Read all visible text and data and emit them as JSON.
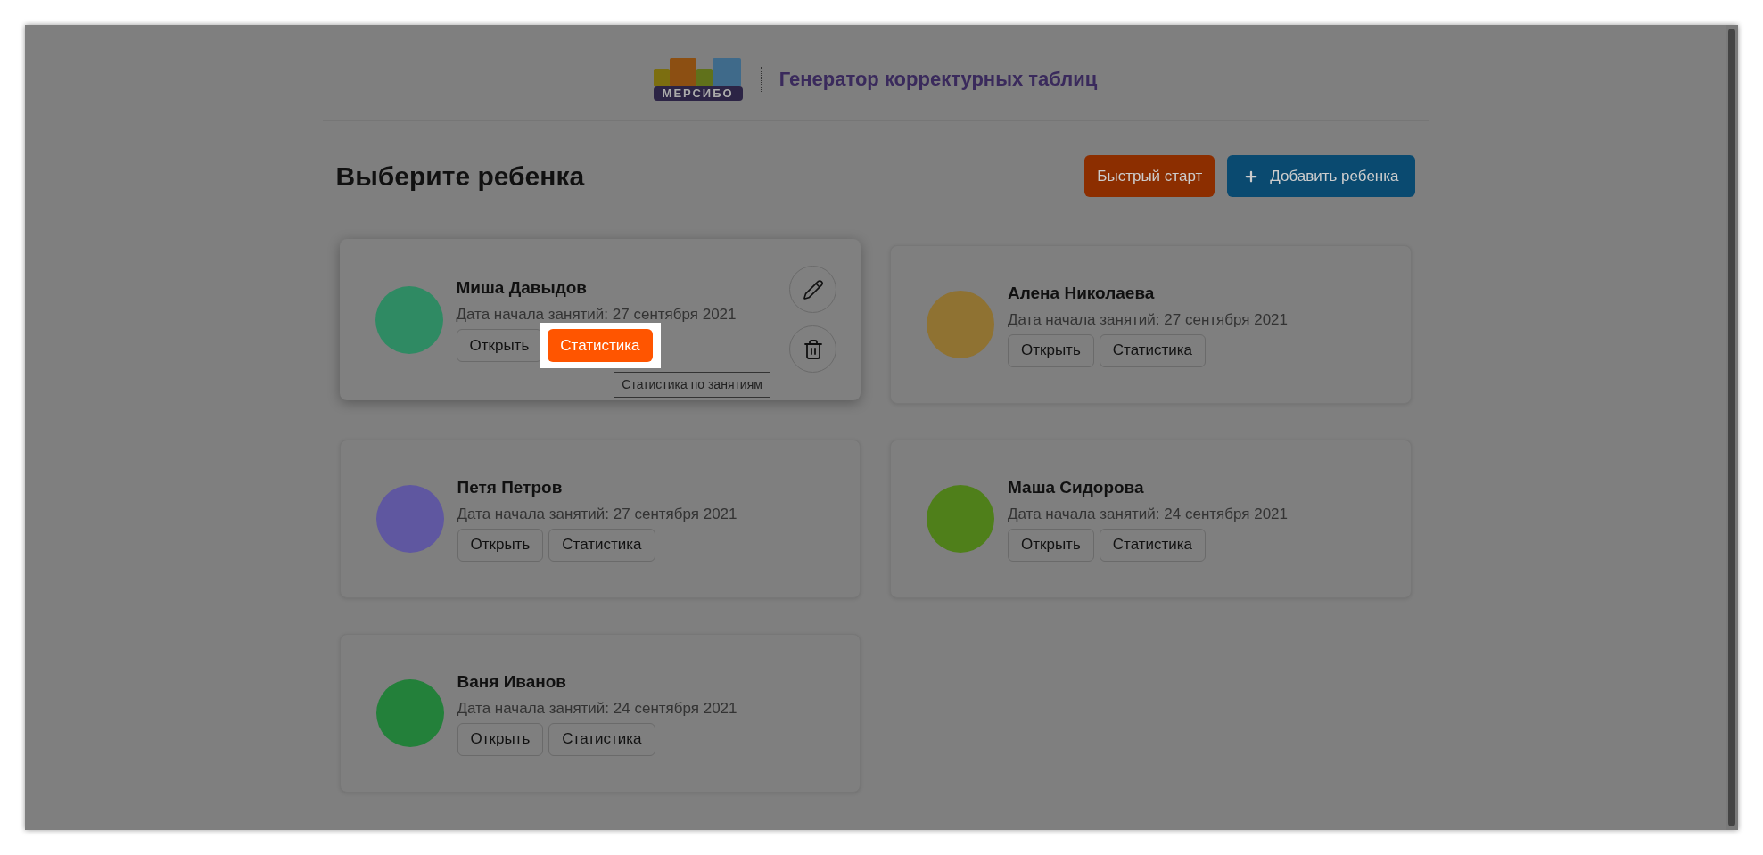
{
  "header": {
    "logo_text": "МЕРСИБО",
    "title": "Генератор корректурных таблиц"
  },
  "page_title": "Выберите ребенка",
  "actions": [
    {
      "kind": "quick",
      "label": "Быстрый старт"
    },
    {
      "kind": "add",
      "label": "Добавить ребенка"
    }
  ],
  "children": [
    {
      "name": "Миша Давыдов",
      "date": "Дата начала занятий: 27 сентября 2021",
      "color": "#2f8a63",
      "hovered": true,
      "buttons": [
        {
          "label": "Открыть",
          "highlighted": false
        },
        {
          "label": "Статистика",
          "highlighted": true,
          "tooltip": "Статистика по занятиям"
        }
      ]
    },
    {
      "name": "Алена Николаева",
      "date": "Дата начала занятий: 27 сентября 2021",
      "color": "#8f7232",
      "hovered": false,
      "buttons": [
        {
          "label": "Открыть",
          "highlighted": false
        },
        {
          "label": "Статистика",
          "highlighted": false
        }
      ]
    },
    {
      "name": "Петя Петров",
      "date": "Дата начала занятий: 27 сентября 2021",
      "color": "#5f57a0",
      "hovered": false,
      "buttons": [
        {
          "label": "Открыть",
          "highlighted": false
        },
        {
          "label": "Статистика",
          "highlighted": false
        }
      ]
    },
    {
      "name": "Маша Сидорова",
      "date": "Дата начала занятий: 24 сентября 2021",
      "color": "#4f7f1a",
      "hovered": false,
      "buttons": [
        {
          "label": "Открыть",
          "highlighted": false
        },
        {
          "label": "Статистика",
          "highlighted": false
        }
      ]
    },
    {
      "name": "Ваня Иванов",
      "date": "Дата начала занятий: 24 сентября 2021",
      "color": "#23803a",
      "hovered": false,
      "buttons": [
        {
          "label": "Открыть",
          "highlighted": false
        },
        {
          "label": "Статистика",
          "highlighted": false
        }
      ]
    }
  ]
}
